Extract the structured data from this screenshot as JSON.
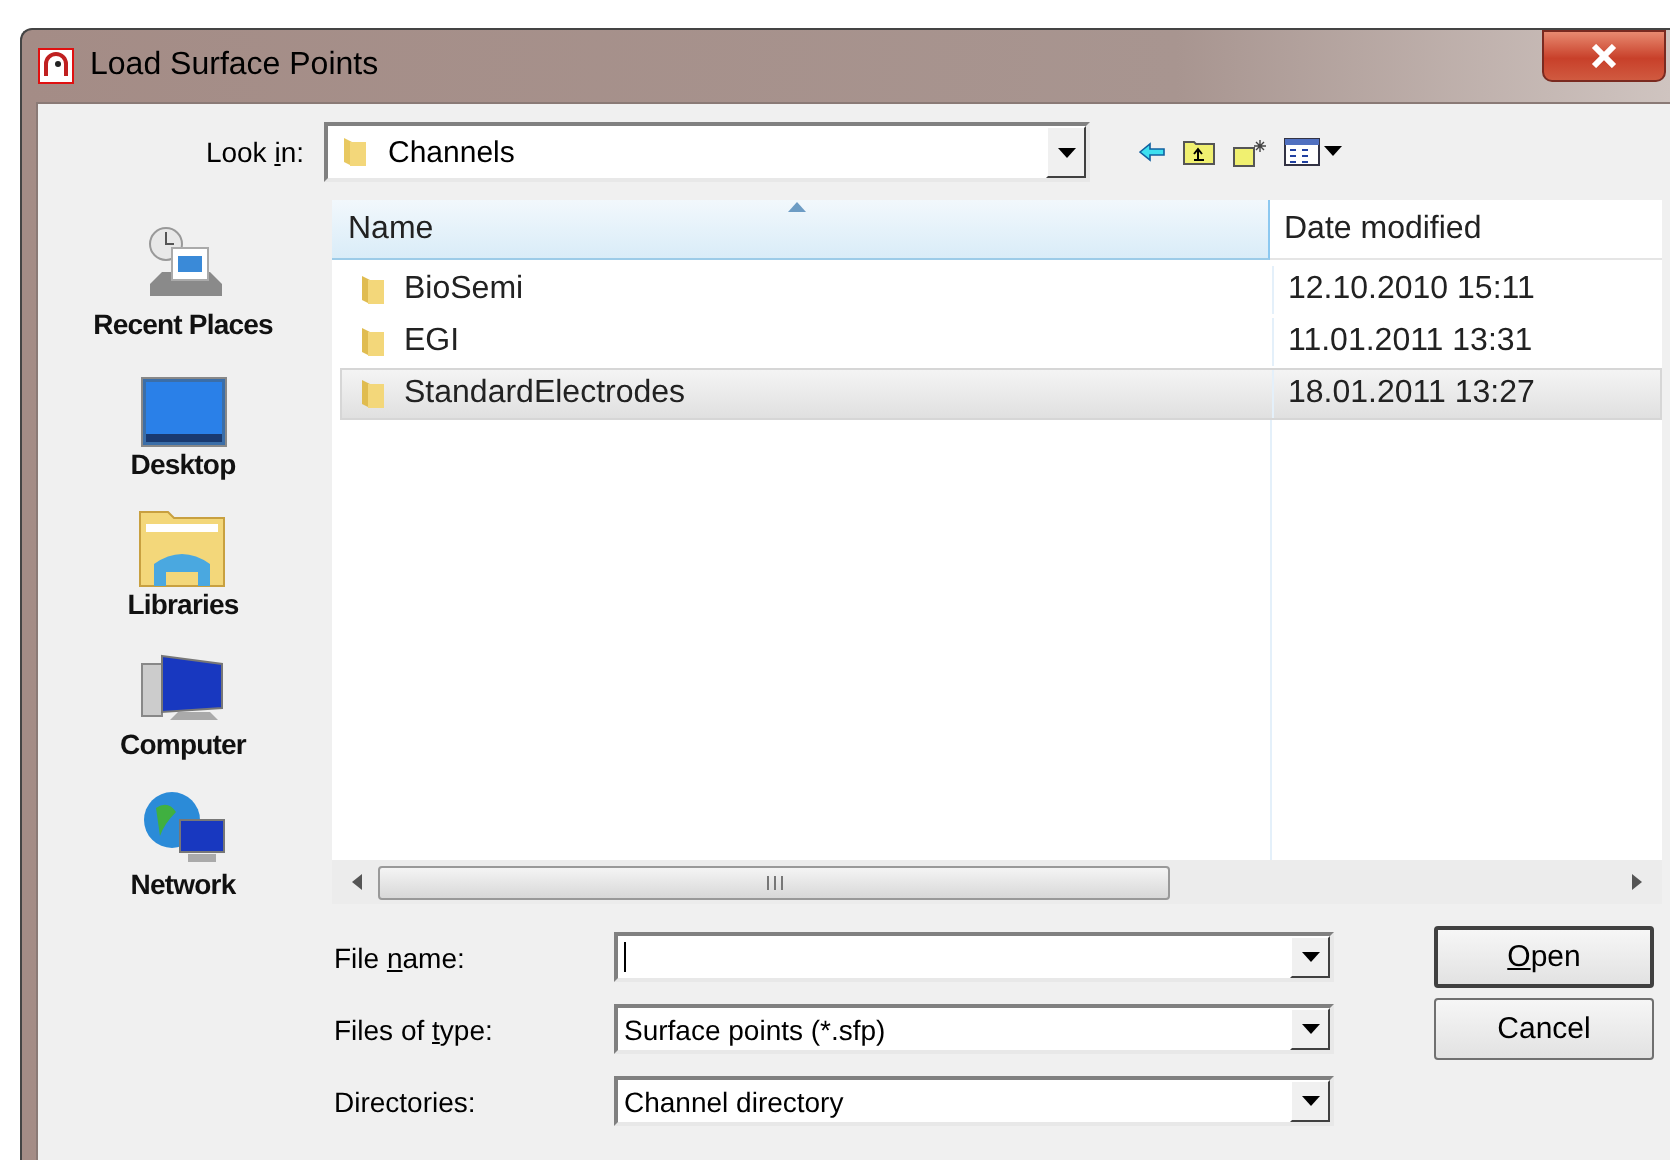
{
  "window": {
    "title": "Load Surface Points"
  },
  "look_in": {
    "label": {
      "before": "Look ",
      "key": "i",
      "after": "n:"
    },
    "value": "Channels"
  },
  "places": [
    {
      "kind": "recent",
      "label": "Recent Places"
    },
    {
      "kind": "desktop",
      "label": "Desktop"
    },
    {
      "kind": "libraries",
      "label": "Libraries"
    },
    {
      "kind": "computer",
      "label": "Computer"
    },
    {
      "kind": "network",
      "label": "Network"
    }
  ],
  "file_list": {
    "columns": [
      "Name",
      "Date modified"
    ],
    "rows": [
      {
        "name": "BioSemi",
        "date": "12.10.2010 15:11",
        "selected": false
      },
      {
        "name": "EGI",
        "date": "11.01.2011 13:31",
        "selected": false
      },
      {
        "name": "StandardElectrodes",
        "date": "18.01.2011 13:27",
        "selected": true
      }
    ]
  },
  "fields": [
    {
      "label": {
        "before": "File ",
        "key": "n",
        "after": "ame:"
      }
    },
    {
      "label": {
        "before": "Files of ",
        "key": "t",
        "after": "ype:"
      },
      "value": "Surface points (*.sfp)"
    },
    {
      "label": {
        "before": "Directories:"
      },
      "value": "Channel directory"
    }
  ],
  "buttons": [
    {
      "label": {
        "key": "O",
        "after": "pen"
      },
      "default": true
    },
    {
      "label": {
        "before": "Cancel"
      },
      "default": false
    }
  ]
}
